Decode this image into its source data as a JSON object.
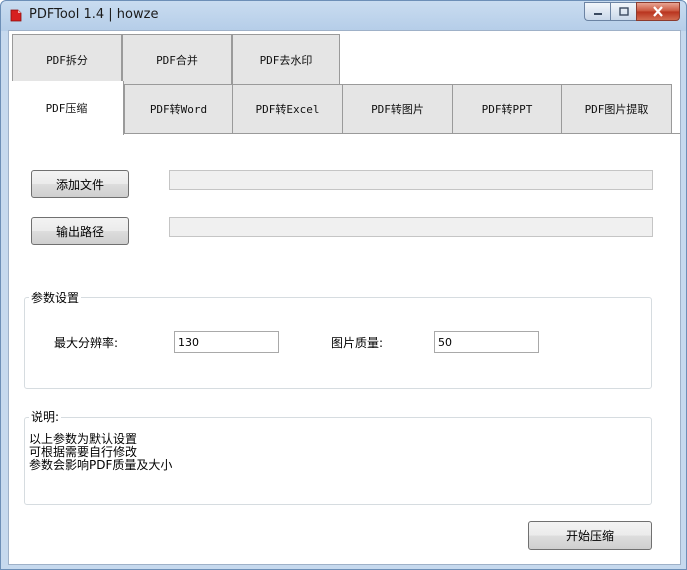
{
  "window": {
    "title": "PDFTool 1.4 |  howze"
  },
  "tabs_row1": [
    {
      "label": "PDF拆分"
    },
    {
      "label": "PDF合并"
    },
    {
      "label": "PDF去水印"
    }
  ],
  "tabs_row2": [
    {
      "label": "PDF压缩",
      "active": true
    },
    {
      "label": "PDF转Word"
    },
    {
      "label": "PDF转Excel"
    },
    {
      "label": "PDF转图片"
    },
    {
      "label": "PDF转PPT"
    },
    {
      "label": "PDF图片提取"
    }
  ],
  "panel": {
    "add_file_label": "添加文件",
    "output_path_label": "输出路径",
    "add_file_value": "",
    "output_path_value": "",
    "params_group_title": "参数设置",
    "max_resolution_label": "最大分辨率:",
    "max_resolution_value": "130",
    "image_quality_label": "图片质量:",
    "image_quality_value": "50",
    "desc_group_title": "说明:",
    "desc_lines": [
      "以上参数为默认设置",
      "可根据需要自行修改",
      "参数会影响PDF质量及大小"
    ],
    "start_button_label": "开始压缩"
  },
  "colors": {
    "title_bar": "#c9dcf0",
    "close_button": "#c9523a",
    "tab_inactive": "#e5e5e5"
  }
}
